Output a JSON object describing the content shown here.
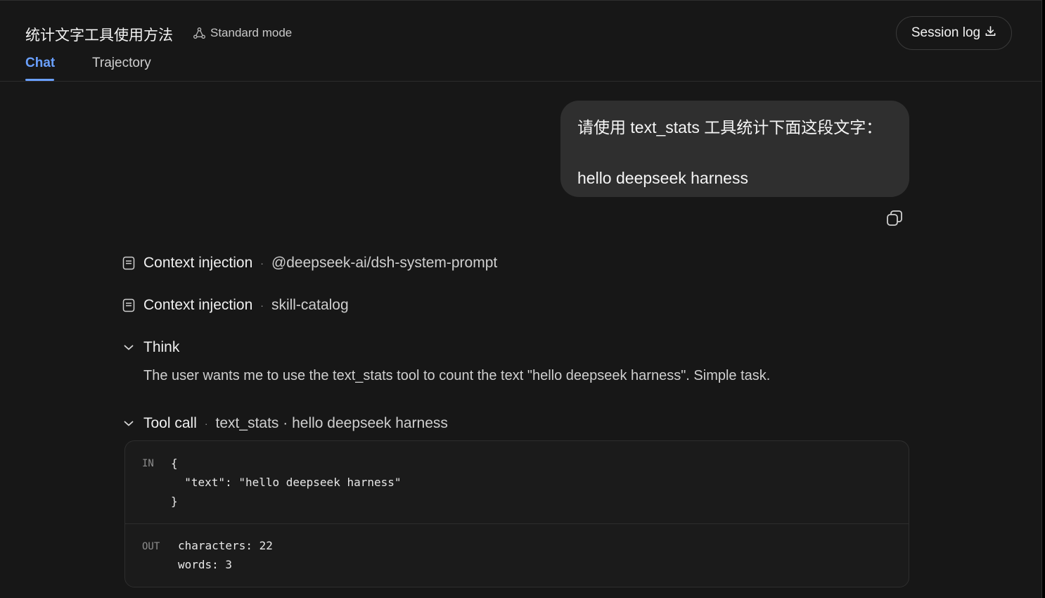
{
  "header": {
    "title": "统计文字工具使用方法",
    "mode_label": "Standard mode",
    "session_log_label": "Session log"
  },
  "tabs": [
    {
      "label": "Chat",
      "active": true
    },
    {
      "label": "Trajectory",
      "active": false
    }
  ],
  "user_message": {
    "line1": "请使用 text_stats 工具统计下面这段文字：",
    "line2": "hello deepseek harness"
  },
  "steps": {
    "context1": {
      "label": "Context injection",
      "separator": "·",
      "detail": "@deepseek-ai/dsh-system-prompt"
    },
    "context2": {
      "label": "Context injection",
      "separator": "·",
      "detail": "skill-catalog"
    },
    "think": {
      "label": "Think",
      "text": "The user wants me to use the text_stats tool to count the text \"hello deepseek harness\". Simple task."
    },
    "tool_call": {
      "label": "Tool call",
      "separator": "·",
      "detail": "text_stats · hello deepseek harness",
      "in_tag": "IN",
      "in_code": "{\n  \"text\": \"hello deepseek harness\"\n}",
      "out_tag": "OUT",
      "out_code": "characters: 22\nwords: 3"
    }
  },
  "colors": {
    "accent": "#6aa0ff",
    "background": "#171717",
    "bubble": "#2f2f2f"
  }
}
